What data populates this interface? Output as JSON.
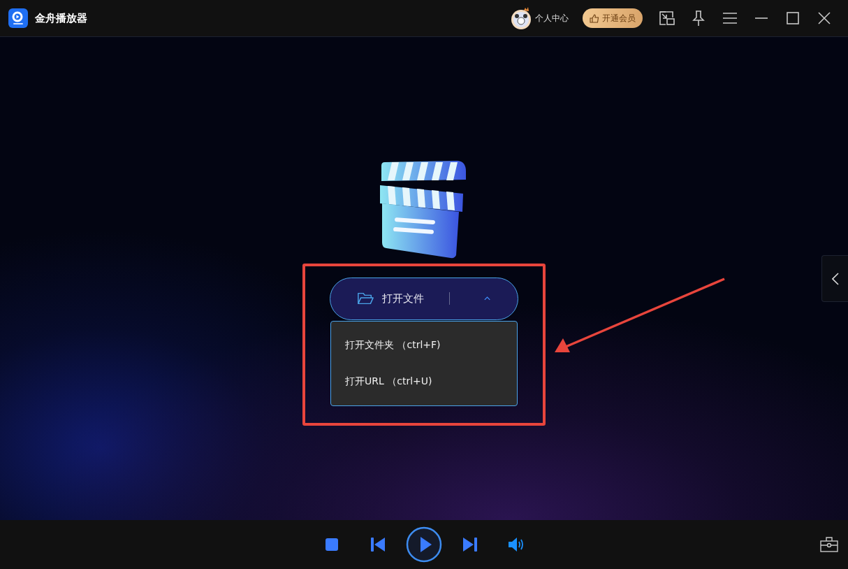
{
  "window": {
    "title": "金舟播放器"
  },
  "header": {
    "user_label": "个人中心",
    "vip_button": "开通会员"
  },
  "open_button": {
    "label": "打开文件",
    "expanded": true
  },
  "open_menu": [
    {
      "label": "打开文件夹 （ctrl+F)"
    },
    {
      "label": "打开URL （ctrl+U)"
    }
  ],
  "side_panel": {
    "expanded": false
  }
}
